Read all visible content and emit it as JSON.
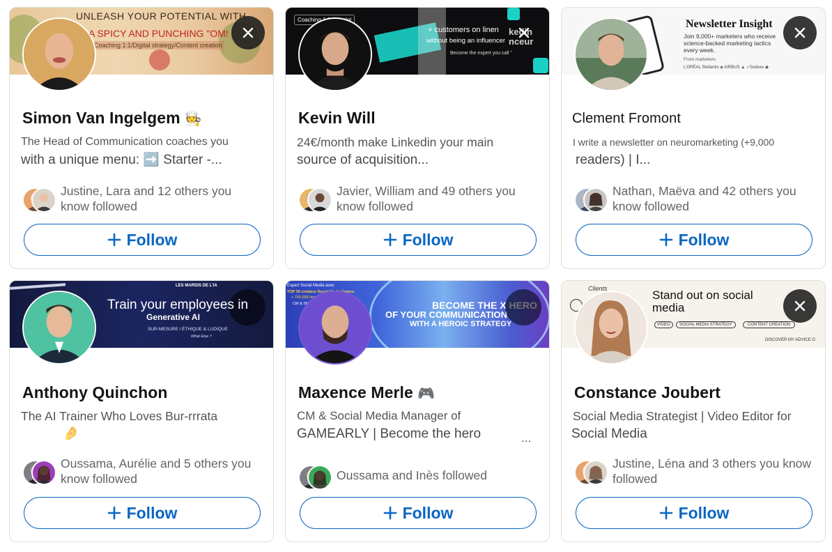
{
  "cards": [
    {
      "name": "Simon Van Ingelgem",
      "name_badge": "🧑‍🍳",
      "headline_line1": "The Head of Communication coaches you",
      "headline_line2": "with a unique menu:    ➡️ Starter  -...",
      "mutual": "Justine, Lara and 12 others you know followed",
      "follow_label": "Follow",
      "banner": {
        "line1": "UNLEASH YOUR POTENTIAL WITH",
        "line2": "A SPICY AND PUNCHING \"OM!",
        "line3": "Coaching 1:1/Digital strategy/Content creation"
      }
    },
    {
      "name": "Kevin Will",
      "name_badge": "",
      "headline_line1": "24€/month make Linkedin your main",
      "headline_line2": "source of acquisition...",
      "mutual": "Javier, William and 49 others you know followed",
      "follow_label": "Follow",
      "banner": {
        "tag": "Coaching 1:1 complet",
        "line1": "+ customers on linen",
        "line2": "without being an influencer",
        "line3": "Become the expert you call \"",
        "side": "kedin nceur"
      }
    },
    {
      "name": "Clement Fromont",
      "name_badge": "",
      "headline_line1": "I write a newsletter on neuromarketing (+9,000",
      "headline_line2": "readers) | I...",
      "mutual": "Nathan, Maëva and 42 others you know followed",
      "follow_label": "Follow",
      "banner": {
        "title": "Newsletter Insight",
        "line1": "Join 9,000+ marketers who receive",
        "line2": "science-backed marketing tactics",
        "line3": "every week.",
        "line4": "From marketers",
        "logos": "L'ORÉAL   Stellantis   ◈   AIRBUS   ▲   ✓Sodexo   ◉"
      }
    },
    {
      "name": "Anthony Quinchon",
      "name_badge": "",
      "headline_line1": "The AI Trainer Who Loves Bur-rrrata",
      "headline_line2": "🤌",
      "mutual": "Oussama, Aurélie and 5 others you know followed",
      "follow_label": "Follow",
      "banner": {
        "line1": "Train your employees in",
        "line2": "Generative AI",
        "line3": "SUR-MESURE / ÉTHIQUE & LUDIQUE",
        "line4": "What Else ?",
        "tag": "LES MARDIS DE L'IA"
      }
    },
    {
      "name": "Maxence Merle",
      "name_badge": "🎮",
      "headline_line1": "CM & Social Media Manager of",
      "headline_line2": "GAMEARLY | Become the hero",
      "headline_ellipsis": "...",
      "mutual": "Oussama and Inès followed",
      "follow_label": "Follow",
      "banner": {
        "line1": "BECOME THE X HERO",
        "line2": "OF YOUR COMMUNICATION",
        "line3": "WITH A HEROIC STRATEGY",
        "tag": "Expert Social Media avec",
        "tag2": "TOP 30 créateur Social Media France",
        "tag3": "+ 700.000 impr",
        "tag4": "CM & SMM"
      }
    },
    {
      "name": "Constance Joubert",
      "name_badge": "",
      "headline_line1": "Social Media Strategist | Video Editor for",
      "headline_line2": "Social Media",
      "mutual": "Justine, Léna and 3 others you know followed",
      "follow_label": "Follow",
      "banner": {
        "line1": "Stand out on social",
        "line2": "media",
        "pill1": "VIDEO",
        "pill2": "SOCIAL MEDIA STRATEGY",
        "pill3": "CONTENT CREATION",
        "footer": "DISCOVER MY ADVICE O",
        "script": "Clients"
      }
    }
  ]
}
